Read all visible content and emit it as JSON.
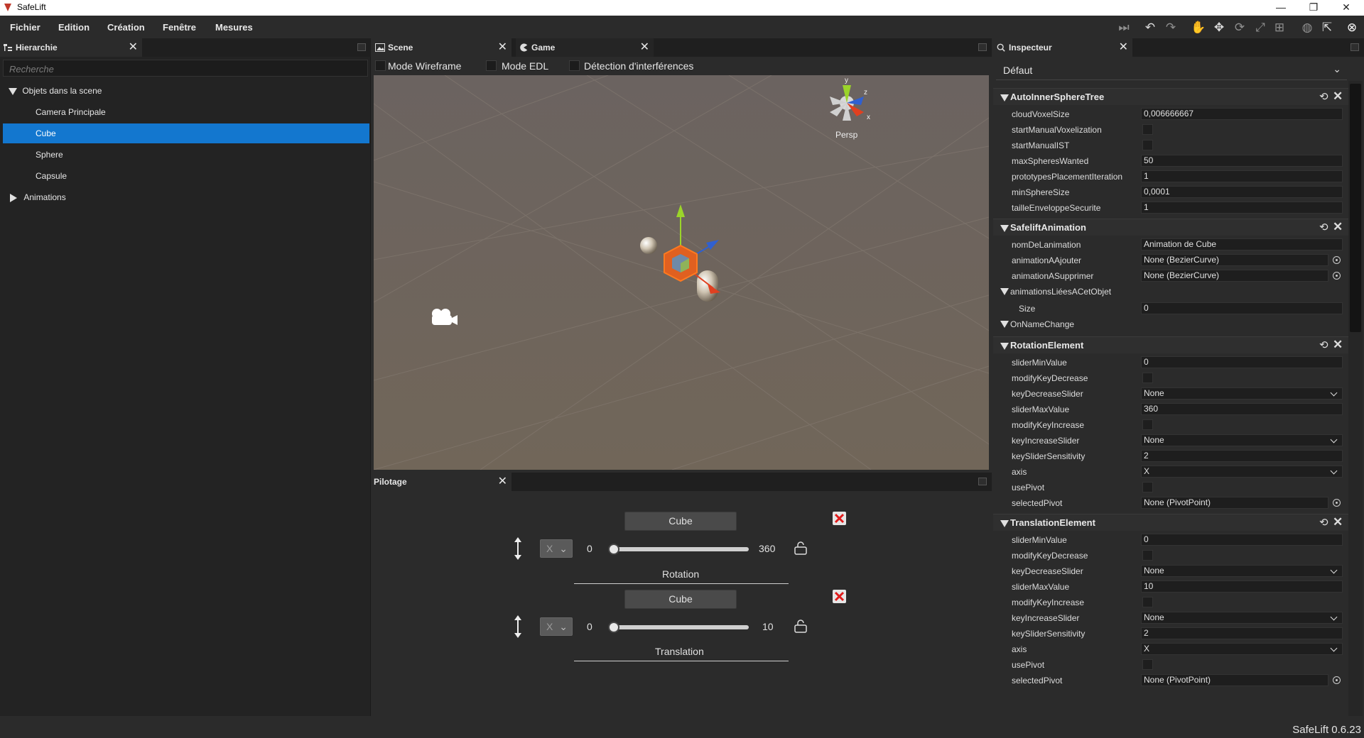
{
  "window": {
    "title": "SafeLift",
    "controls": [
      "—",
      "❐",
      "✕"
    ]
  },
  "menubar": {
    "items": [
      "Fichier",
      "Edition",
      "Création",
      "Fenêtre",
      "Mesures"
    ]
  },
  "toolbar": {
    "icons": [
      "step-icon",
      "undo-icon",
      "redo-icon",
      "hand-icon",
      "move-icon",
      "rotate-icon",
      "scale-icon",
      "rect-icon",
      "globe-icon",
      "pivot-icon",
      "gizmo-icon"
    ]
  },
  "hierarchy": {
    "tab_label": "Hierarchie",
    "search_placeholder": "Recherche",
    "items": [
      {
        "label": "Objets dans la scene",
        "expanded": true,
        "level": 0
      },
      {
        "label": "Camera Principale",
        "level": 1
      },
      {
        "label": "Cube",
        "level": 1,
        "selected": true
      },
      {
        "label": "Sphere",
        "level": 1
      },
      {
        "label": "Capsule",
        "level": 1
      },
      {
        "label": "Animations",
        "expanded": false,
        "level": 0
      }
    ]
  },
  "scene": {
    "tabs": [
      "Scene",
      "Game"
    ],
    "options": [
      "Mode Wireframe",
      "Mode EDL",
      "Détection d'interférences"
    ],
    "gizmo_label": "Persp",
    "gizmo_axes": [
      "y",
      "z",
      "x"
    ]
  },
  "pilotage": {
    "tab_label": "Pilotage",
    "controllers": [
      {
        "object": "Cube",
        "axis": "X",
        "min": "0",
        "max": "360",
        "value_fraction": 0.0,
        "label": "Rotation"
      },
      {
        "object": "Cube",
        "axis": "X",
        "min": "0",
        "max": "10",
        "value_fraction": 0.0,
        "label": "Translation"
      }
    ]
  },
  "inspector": {
    "tab_label": "Inspecteur",
    "preset": "Défaut",
    "sections": [
      {
        "title": "AutoInnerSphereTree",
        "props": [
          {
            "name": "cloudVoxelSize",
            "type": "text",
            "value": "0,006666667"
          },
          {
            "name": "startManualVoxelization",
            "type": "check"
          },
          {
            "name": "startManualIST",
            "type": "check"
          },
          {
            "name": "maxSpheresWanted",
            "type": "text",
            "value": "50"
          },
          {
            "name": "prototypesPlacementIteration",
            "type": "text",
            "value": "1"
          },
          {
            "name": "minSphereSize",
            "type": "text",
            "value": "0,0001"
          },
          {
            "name": "tailleEnveloppeSecurite",
            "type": "text",
            "value": "1"
          }
        ]
      },
      {
        "title": "SafeliftAnimation",
        "props": [
          {
            "name": "nomDeLanimation",
            "type": "text",
            "value": "Animation de Cube"
          },
          {
            "name": "animationAAjouter",
            "type": "obj",
            "value": "None (BezierCurve)"
          },
          {
            "name": "animationASupprimer",
            "type": "obj",
            "value": "None (BezierCurve)"
          },
          {
            "name": "animationsLiéesACetObjet",
            "type": "group"
          },
          {
            "name": "Size",
            "type": "text",
            "value": "0",
            "indent": true
          },
          {
            "name": "OnNameChange",
            "type": "group"
          }
        ]
      },
      {
        "title": "RotationElement",
        "props": [
          {
            "name": "sliderMinValue",
            "type": "text",
            "value": "0"
          },
          {
            "name": "modifyKeyDecrease",
            "type": "check"
          },
          {
            "name": "keyDecreaseSlider",
            "type": "drop",
            "value": "None"
          },
          {
            "name": "sliderMaxValue",
            "type": "text",
            "value": "360"
          },
          {
            "name": "modifyKeyIncrease",
            "type": "check"
          },
          {
            "name": "keyIncreaseSlider",
            "type": "drop",
            "value": "None"
          },
          {
            "name": "keySliderSensitivity",
            "type": "text",
            "value": "2"
          },
          {
            "name": "axis",
            "type": "drop",
            "value": "X"
          },
          {
            "name": "usePivot",
            "type": "check"
          },
          {
            "name": "selectedPivot",
            "type": "obj",
            "value": "None (PivotPoint)"
          }
        ]
      },
      {
        "title": "TranslationElement",
        "props": [
          {
            "name": "sliderMinValue",
            "type": "text",
            "value": "0"
          },
          {
            "name": "modifyKeyDecrease",
            "type": "check"
          },
          {
            "name": "keyDecreaseSlider",
            "type": "drop",
            "value": "None"
          },
          {
            "name": "sliderMaxValue",
            "type": "text",
            "value": "10"
          },
          {
            "name": "modifyKeyIncrease",
            "type": "check"
          },
          {
            "name": "keyIncreaseSlider",
            "type": "drop",
            "value": "None"
          },
          {
            "name": "keySliderSensitivity",
            "type": "text",
            "value": "2"
          },
          {
            "name": "axis",
            "type": "drop",
            "value": "X"
          },
          {
            "name": "usePivot",
            "type": "check"
          },
          {
            "name": "selectedPivot",
            "type": "obj",
            "value": "None (PivotPoint)"
          }
        ]
      }
    ]
  },
  "status": {
    "version": "SafeLift 0.6.23"
  },
  "colors": {
    "selection": "#1377cf",
    "close_red": "#e01b1b",
    "viewport": "#6e645c"
  }
}
